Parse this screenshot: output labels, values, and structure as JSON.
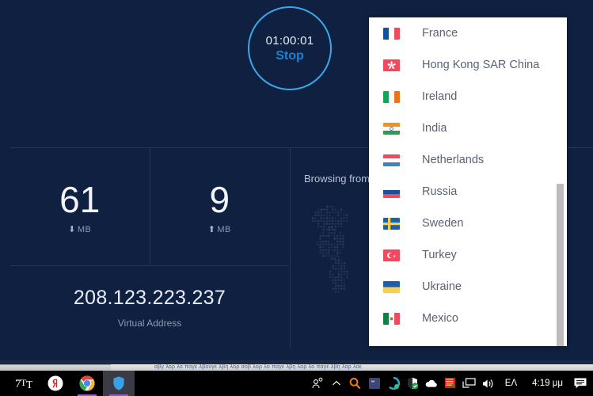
{
  "app": {
    "timer": {
      "time": "01:00:01",
      "action_label": "Stop",
      "ring_color": "#3aa8e8",
      "action_color": "#1b81d6"
    },
    "stats": [
      {
        "value": "61",
        "unit": "MB",
        "direction": "down",
        "arrow": "⬇"
      },
      {
        "value": "9",
        "unit": "MB",
        "direction": "up",
        "arrow": "⬆"
      }
    ],
    "ip": {
      "value": "208.123.223.237",
      "label": "Virtual Address"
    },
    "browsing": {
      "label": "Browsing from"
    },
    "background_color": "#0f2040"
  },
  "dropdown": {
    "items": [
      {
        "label": "France",
        "flag": "france"
      },
      {
        "label": "Hong Kong SAR China",
        "flag": "hongkong"
      },
      {
        "label": "Ireland",
        "flag": "ireland"
      },
      {
        "label": "India",
        "flag": "india"
      },
      {
        "label": "Netherlands",
        "flag": "netherlands"
      },
      {
        "label": "Russia",
        "flag": "russia"
      },
      {
        "label": "Sweden",
        "flag": "sweden"
      },
      {
        "label": "Turkey",
        "flag": "turkey"
      },
      {
        "label": "Ukraine",
        "flag": "ukraine"
      },
      {
        "label": "Mexico",
        "flag": "mexico"
      }
    ]
  },
  "background_window": {
    "strip_text": "αβγ λορ λο παγε λβονγε λβη λορ αοβ λορ λο παγε λβη λορ λο παγε λβη λορ λοε"
  },
  "taskbar": {
    "apps": [
      {
        "name": "7tt",
        "label": "7TT"
      },
      {
        "name": "yandex-browser",
        "label": "Y"
      },
      {
        "name": "google-chrome",
        "label": ""
      },
      {
        "name": "vpn-shield",
        "label": ""
      }
    ],
    "tray": {
      "show_hidden": "ⱏ",
      "keyboard_language": "ΕΛ",
      "clock": "4:19 μμ"
    }
  }
}
